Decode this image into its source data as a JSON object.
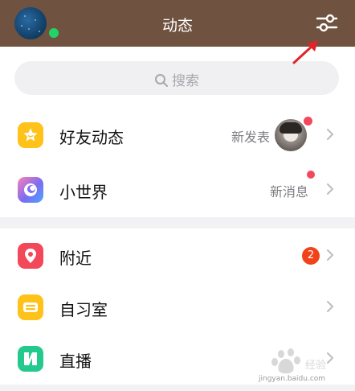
{
  "header": {
    "title": "动态",
    "avatar": "user-avatar",
    "online_status_color": "#22d36a",
    "filter_icon": "sliders-icon"
  },
  "search": {
    "placeholder": "搜索",
    "icon": "search-icon"
  },
  "items": [
    {
      "icon": "star-icon",
      "label": "好友动态",
      "right_text": "新发表",
      "has_thumbnail": true,
      "unread_dot": true,
      "icon_color": "#ffc21a"
    },
    {
      "icon": "planet-icon",
      "label": "小世界",
      "right_text": "新消息",
      "unread_dot": true,
      "icon_color": "#7b6cf2"
    },
    {
      "icon": "location-pin-icon",
      "label": "附近",
      "badge": "2",
      "icon_color": "#f2485a"
    },
    {
      "icon": "study-room-icon",
      "label": "自习室",
      "icon_color": "#ffc21a"
    },
    {
      "icon": "live-icon",
      "label": "直播",
      "icon_color": "#24c98d"
    }
  ],
  "watermark": {
    "text": "jingyan.baidu.com"
  },
  "colors": {
    "header_bg": "#6f5240",
    "accent_red": "#f5475b",
    "badge_red": "#f0431a",
    "annotation_arrow": "#e0252a"
  }
}
